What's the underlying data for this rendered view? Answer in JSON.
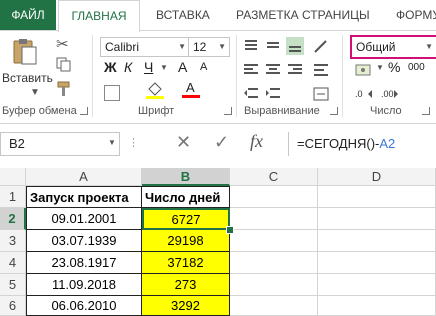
{
  "tabs": [
    "ФАЙЛ",
    "ГЛАВНАЯ",
    "ВСТАВКА",
    "РАЗМЕТКА СТРАНИЦЫ",
    "ФОРМУ"
  ],
  "ribbon": {
    "paste_label": "Вставить",
    "clipboard_label": "Буфер обмена",
    "font_name": "Calibri",
    "font_size": "12",
    "font_label": "Шрифт",
    "bold": "Ж",
    "italic": "К",
    "underline": "Ч",
    "font_grow": "A",
    "font_shrink": "A",
    "alignment_label": "Выравнивание",
    "number_format": "Общий",
    "number_label": "Число",
    "percent": "%",
    "thousands": "000"
  },
  "formula_bar": {
    "cell_ref": "B2",
    "formula_text": "=СЕГОДНЯ()-",
    "formula_ref": "A2"
  },
  "sheet": {
    "columns": [
      "A",
      "B",
      "C",
      "D"
    ],
    "rows": [
      "1",
      "2",
      "3",
      "4",
      "5",
      "6"
    ],
    "header": [
      "Запуск проекта",
      "Число дней"
    ],
    "data": [
      [
        "09.01.2001",
        "6727"
      ],
      [
        "03.07.1939",
        "29198"
      ],
      [
        "23.08.1917",
        "37182"
      ],
      [
        "11.09.2018",
        "273"
      ],
      [
        "06.06.2010",
        "3292"
      ]
    ]
  },
  "colors": {
    "accent": "#217346",
    "highlight": "#ffff00",
    "formula_ref": "#3c78d8",
    "selection_border": "#217346"
  }
}
